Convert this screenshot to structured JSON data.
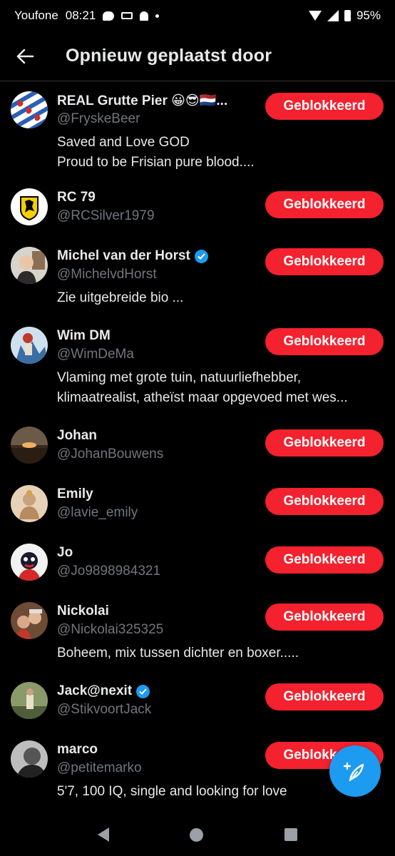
{
  "status_bar": {
    "carrier": "Youfone",
    "time": "08:21",
    "battery": "95%"
  },
  "header": {
    "back_icon": "arrow-left-icon",
    "title": "Opnieuw geplaatst door"
  },
  "users": [
    {
      "name": "REAL Grutte Pier 😀😎🇳🇱...",
      "handle": "@FryskeBeer",
      "verified": false,
      "bio": [
        "Saved and Love GOD",
        "Proud to be Frisian pure blood...."
      ],
      "button": "Geblokkeerd"
    },
    {
      "name": "RC 79",
      "handle": "@RCSilver1979",
      "verified": false,
      "bio": [],
      "button": "Geblokkeerd"
    },
    {
      "name": "Michel van der Horst",
      "handle": "@MichelvdHorst",
      "verified": true,
      "bio": [
        "Zie uitgebreide bio ..."
      ],
      "button": "Geblokkeerd"
    },
    {
      "name": "Wim DM",
      "handle": "@WimDeMa",
      "verified": false,
      "bio": [
        "Vlaming met grote tuin, natuurliefhebber,",
        "klimaatrealist, atheïst maar opgevoed met  wes..."
      ],
      "button": "Geblokkeerd"
    },
    {
      "name": "Johan",
      "handle": "@JohanBouwens",
      "verified": false,
      "bio": [],
      "button": "Geblokkeerd"
    },
    {
      "name": "Emily",
      "handle": "@lavie_emily",
      "verified": false,
      "bio": [],
      "button": "Geblokkeerd"
    },
    {
      "name": "Jo",
      "handle": "@Jo9898984321",
      "verified": false,
      "bio": [],
      "button": "Geblokkeerd"
    },
    {
      "name": "Nickolai",
      "handle": "@Nickolai325325",
      "verified": false,
      "bio": [
        "Boheem, mix tussen dichter en boxer....."
      ],
      "button": "Geblokkeerd"
    },
    {
      "name": "Jack@nexit",
      "handle": "@StikvoortJack",
      "verified": true,
      "bio": [],
      "button": "Geblokkeerd"
    },
    {
      "name": "marco",
      "handle": "@petitemarko",
      "verified": false,
      "bio": [
        "5'7, 100 IQ, single and looking for love"
      ],
      "button": "Geblokkeerd"
    }
  ],
  "fab": {
    "icon": "compose-feather-icon"
  },
  "colors": {
    "accent": "#1d9bf0",
    "blocked": "#f4212e",
    "background": "#000000",
    "muted": "#71767b"
  }
}
